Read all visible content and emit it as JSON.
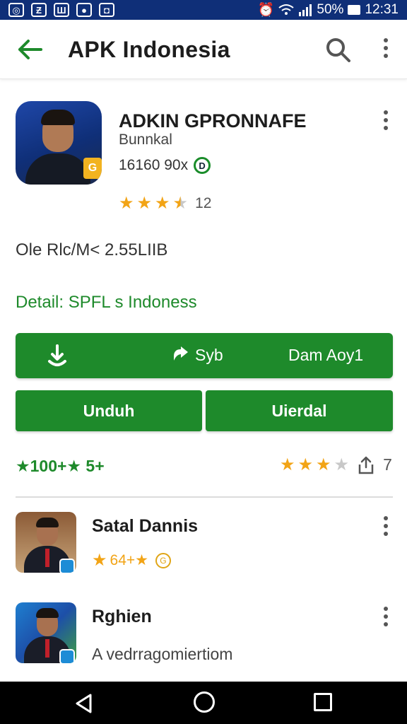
{
  "status_bar": {
    "left_icons": [
      "notification-icon-1",
      "notification-icon-2",
      "notification-icon-3",
      "notification-icon-4",
      "notification-icon-5"
    ],
    "left_glyphs": [
      "◎",
      "Ƶ",
      "Ш",
      "●",
      "◘"
    ],
    "battery_text": "50%",
    "time": "12:31"
  },
  "app_bar": {
    "title": "APK Indonesia"
  },
  "app": {
    "name": "ADKIN GPRONNAFE",
    "developer": "Bunnkal",
    "size": "16160 90x",
    "size_badge": "D",
    "icon_badge": "G",
    "rating_stars": 3.5,
    "rating_count": "12"
  },
  "meta_line": "Ole Rlc/M< 2.55LIIB",
  "details_line": "Detail: SPFL s Indoness",
  "wide_bar": {
    "segment_2_label": "Syb",
    "segment_3_label": "Dam Aoy1"
  },
  "buttons": {
    "left": "Unduh",
    "right": "Uierdal"
  },
  "stats": {
    "left_text": "★100+★ 5+",
    "right_stars": 3,
    "right_count": "7"
  },
  "list": [
    {
      "title": "Satal Dannis",
      "sub": "64+★",
      "coin": "G"
    },
    {
      "title": "Rghien",
      "sub": "A vedrragomiertiom"
    }
  ],
  "colors": {
    "accent_green": "#1e8a2b",
    "status_bar_blue": "#0f2f78",
    "star_gold": "#f2a416"
  }
}
